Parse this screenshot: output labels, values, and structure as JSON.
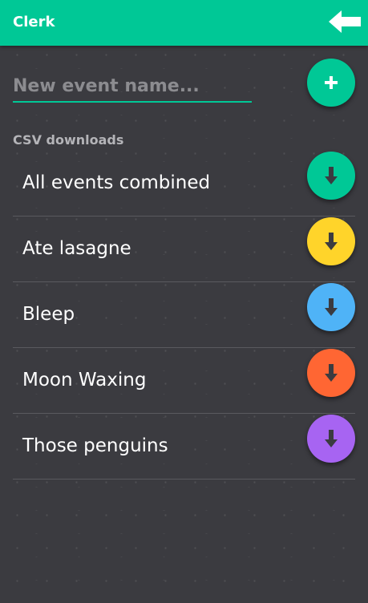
{
  "header": {
    "title": "Clerk",
    "back_icon": "back-arrow-icon"
  },
  "new_event": {
    "value": "",
    "placeholder": "New event name...",
    "add_icon": "plus-icon"
  },
  "downloads": {
    "section_title": "CSV downloads",
    "items": [
      {
        "label": "All events combined",
        "color": "#00c896",
        "icon": "download-arrow-icon"
      },
      {
        "label": "Ate lasagne",
        "color": "#ffd42a",
        "icon": "download-arrow-icon"
      },
      {
        "label": "Bleep",
        "color": "#4fb3f7",
        "icon": "download-arrow-icon"
      },
      {
        "label": "Moon Waxing",
        "color": "#ff6633",
        "icon": "download-arrow-icon"
      },
      {
        "label": "Those penguins",
        "color": "#a764f2",
        "icon": "download-arrow-icon"
      }
    ]
  },
  "colors": {
    "accent": "#00c896",
    "background": "#3b3b40",
    "arrow": "#3b3b40"
  }
}
